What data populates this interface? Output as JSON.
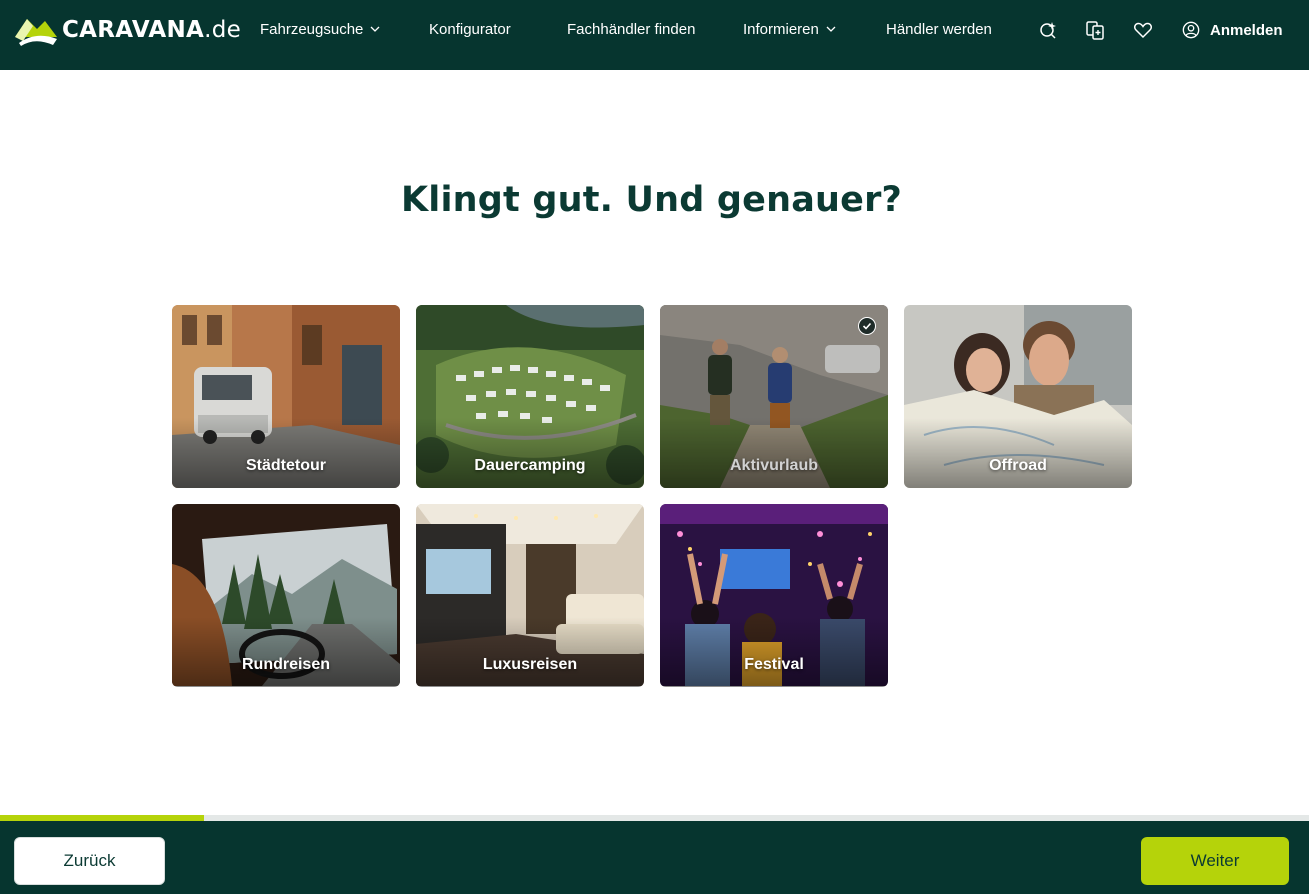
{
  "header": {
    "logo_text": "CARAVANA",
    "logo_tld": ".de",
    "nav": [
      {
        "label": "Fahrzeugsuche",
        "has_dropdown": true
      },
      {
        "label": "Konfigurator",
        "has_dropdown": false
      },
      {
        "label": "Fachhändler finden",
        "has_dropdown": false
      },
      {
        "label": "Informieren",
        "has_dropdown": true
      },
      {
        "label": "Händler werden",
        "has_dropdown": false
      }
    ],
    "icons": [
      "sparkle-search-icon",
      "compare-icon",
      "heart-icon",
      "user-icon"
    ],
    "login_label": "Anmelden"
  },
  "main": {
    "headline": "Klingt gut. Und genauer?",
    "options": [
      {
        "label": "Städtetour",
        "selected": false,
        "image": "camper-van-in-city-street"
      },
      {
        "label": "Dauercamping",
        "selected": false,
        "image": "campsite-aerial-view"
      },
      {
        "label": "Aktivurlaub",
        "selected": true,
        "image": "hikers-in-mountains"
      },
      {
        "label": "Offroad",
        "selected": false,
        "image": "couple-reading-map"
      },
      {
        "label": "Rundreisen",
        "selected": false,
        "image": "driver-on-mountain-road"
      },
      {
        "label": "Luxusreisen",
        "selected": false,
        "image": "luxury-motorhome-interior"
      },
      {
        "label": "Festival",
        "selected": false,
        "image": "concert-crowd"
      }
    ]
  },
  "footer": {
    "progress_fraction": 0.156,
    "back_label": "Zurück",
    "next_label": "Weiter"
  },
  "colors": {
    "brand_dark": "#06352f",
    "accent_lime": "#b5d30a",
    "headline": "#0b3a33"
  }
}
